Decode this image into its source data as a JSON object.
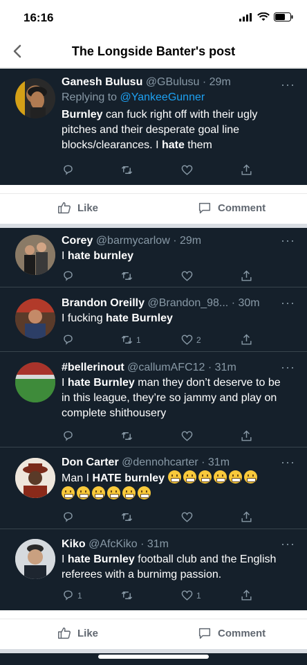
{
  "status": {
    "time": "16:16"
  },
  "nav": {
    "title": "The Longside Banter's post"
  },
  "main_tweet": {
    "name": "Ganesh Bulusu",
    "handle": "@GBulusu",
    "dot": "·",
    "time": "29m",
    "replying_prefix": "Replying to",
    "replying_to": "@YankeeGunner",
    "text_bold_1": "Burnley",
    "text_1": " can fuck right off with their ugly pitches and their desperate goal line blocks/clearances. I ",
    "text_bold_2": "hate",
    "text_2": " them"
  },
  "card_actions": {
    "like": "Like",
    "comment": "Comment"
  },
  "replies": [
    {
      "name": "Corey",
      "handle": "@barmycarlow",
      "dot": "·",
      "time": "29m",
      "pre": "I ",
      "bold": "hate burnley",
      "post": "",
      "reply_count": "",
      "retweet_count": "",
      "like_count": ""
    },
    {
      "name": "Brandon Oreilly",
      "handle": "@Brandon_98...",
      "dot": "·",
      "time": "30m",
      "pre": "I fucking ",
      "bold": "hate Burnley",
      "post": "",
      "reply_count": "",
      "retweet_count": "1",
      "like_count": "2"
    },
    {
      "name": "#bellerinout",
      "handle": "@callumAFC12",
      "dot": "·",
      "time": "31m",
      "pre": "I ",
      "bold": "hate Burnley",
      "post": " man they don’t deserve to be in this league, they’re so jammy and play on complete shithousery",
      "reply_count": "",
      "retweet_count": "",
      "like_count": ""
    },
    {
      "name": "Don Carter",
      "handle": "@dennohcarter",
      "dot": "·",
      "time": "31m",
      "pre": "Man I ",
      "bold": "HATE burnley",
      "post": " ",
      "reply_count": "",
      "retweet_count": "",
      "like_count": ""
    },
    {
      "name": "Kiko",
      "handle": "@AfcKiko",
      "dot": "·",
      "time": "31m",
      "pre": "I ",
      "bold": "hate Burnley",
      "post": " football club and the English referees with a burnimg passion.",
      "reply_count": "1",
      "retweet_count": "",
      "like_count": "1"
    }
  ],
  "icons": [
    "back-chevron",
    "signal",
    "wifi",
    "battery",
    "more-dots",
    "reply",
    "retweet",
    "heart",
    "share",
    "like-thumb",
    "comment-bubble",
    "grimacing-emoji"
  ],
  "colors": {
    "dark_bg": "#15202b",
    "mention": "#1da1f2",
    "muted": "#8899a6"
  }
}
